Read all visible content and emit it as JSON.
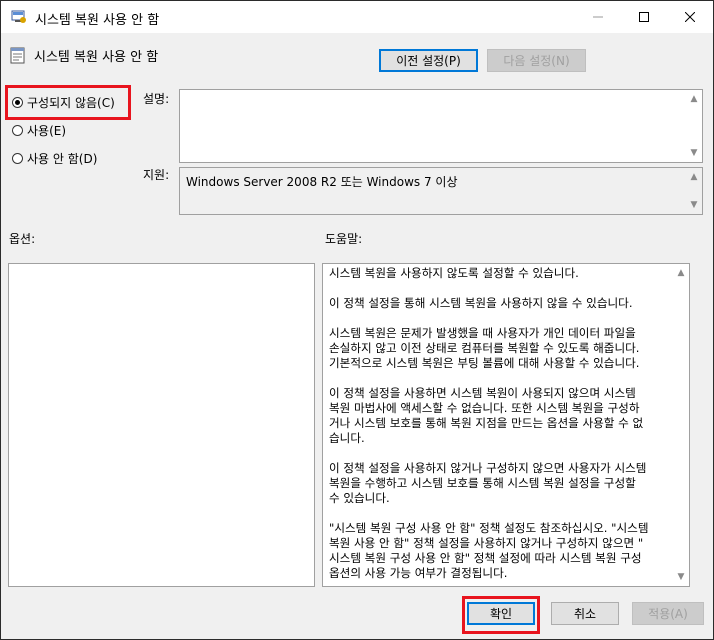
{
  "window": {
    "title": "시스템 복원 사용 안 함",
    "icon": "group-policy-icon",
    "controls": {
      "minimize": "minimize-icon",
      "maximize": "maximize-icon",
      "close": "close-icon"
    }
  },
  "header": {
    "title": "시스템 복원 사용 안 함",
    "icon": "policy-setting-icon",
    "prev_setting": "이전 설정(P)",
    "next_setting": "다음 설정(N)"
  },
  "state_options": [
    {
      "label": "구성되지 않음(C)",
      "checked": true
    },
    {
      "label": "사용(E)",
      "checked": false
    },
    {
      "label": "사용 안 함(D)",
      "checked": false
    }
  ],
  "comment": {
    "label": "설명:",
    "value": ""
  },
  "supported": {
    "label": "지원:",
    "value": "Windows Server 2008 R2 또는 Windows 7 이상"
  },
  "options": {
    "label": "옵션:"
  },
  "help": {
    "label": "도움말:",
    "paragraphs": [
      "시스템 복원을 사용하지 않도록 설정할 수 있습니다.",
      "이 정책 설정을 통해 시스템 복원을 사용하지 않을 수 있습니다.",
      "시스템 복원은 문제가 발생했을 때 사용자가 개인 데이터 파일을\n손실하지 않고 이전 상태로 컴퓨터를 복원할 수 있도록 해줍니다.\n기본적으로 시스템 복원은 부팅 볼륨에 대해 사용할 수 있습니다.",
      "이 정책 설정을 사용하면 시스템 복원이 사용되지 않으며 시스템\n복원 마법사에 액세스할 수 없습니다. 또한 시스템 복원을 구성하\n거나 시스템 보호를 통해 복원 지점을 만드는 옵션을 사용할 수 없\n습니다.",
      "이 정책 설정을 사용하지 않거나 구성하지 않으면 사용자가 시스템\n복원을 수행하고 시스템 보호를 통해 시스템 복원 설정을 구성할\n수 있습니다.",
      "\"시스템 복원 구성 사용 안 함\" 정책 설정도 참조하십시오. \"시스템\n복원 사용 안 함\" 정책 설정을 사용하지 않거나 구성하지 않으면 \"\n시스템 복원 구성 사용 안 함\" 정책 설정에 따라 시스템 복원 구성\n옵션의 사용 가능 여부가 결정됩니다."
    ]
  },
  "footer": {
    "ok": "확인",
    "cancel": "취소",
    "apply": "적용(A)"
  },
  "colors": {
    "highlight": "#e8141e",
    "focus": "#0078d7"
  }
}
